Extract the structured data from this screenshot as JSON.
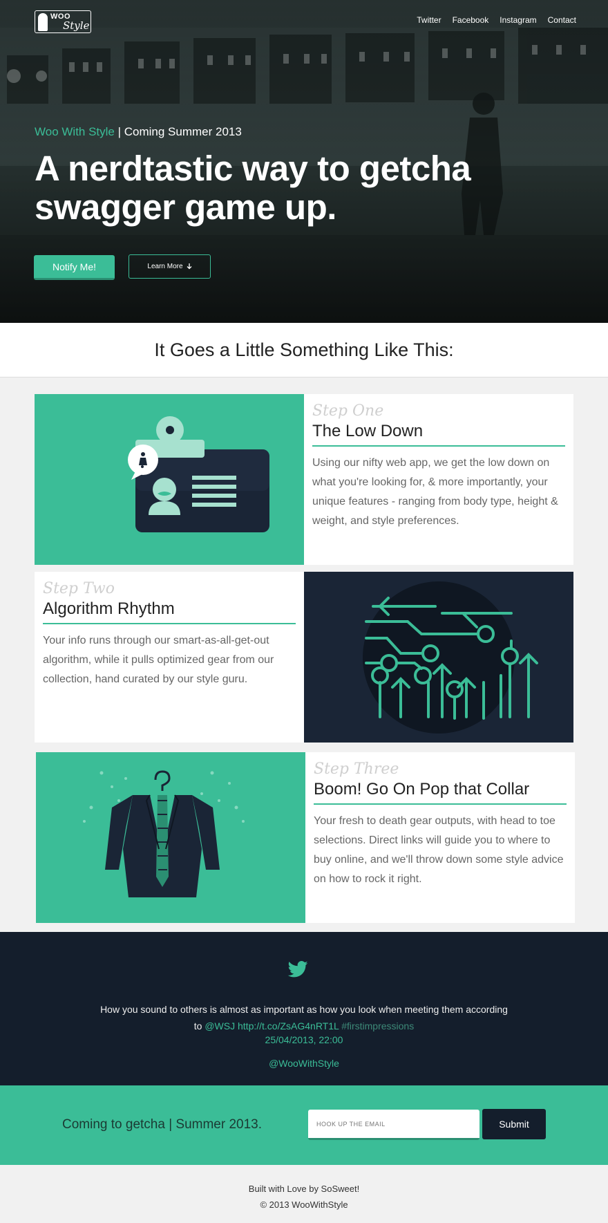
{
  "header": {
    "logo": {
      "line1": "WOO",
      "line2": "Style"
    },
    "nav": [
      "Twitter",
      "Facebook",
      "Instagram",
      "Contact"
    ]
  },
  "hero": {
    "brand": "Woo With Style",
    "tagline_suffix": " | Coming Summer 2013",
    "headline": "A nerdtastic way to getcha swagger game up.",
    "notify_label": "Notify Me!",
    "learn_label": "Learn More"
  },
  "section_title": "It Goes a Little Something Like This:",
  "steps": [
    {
      "label": "Step One",
      "title": "The Low Down",
      "body": "Using our nifty web app, we get the low down on what you're looking for, & more importantly, your unique features - ranging from body type, height & weight, and style preferences."
    },
    {
      "label": "Step Two",
      "title": "Algorithm Rhythm",
      "body": "Your info runs through our smart-as-all-get-out algorithm, while it pulls optimized gear from our collection, hand curated by our style guru."
    },
    {
      "label": "Step Three",
      "title": "Boom! Go On Pop that Collar",
      "body": "Your fresh to death gear outputs, with head to toe selections. Direct links will guide you to where to buy online, and we'll throw down some style advice on how to rock it right."
    }
  ],
  "twitter": {
    "quote_text": "How you sound to others is almost as important as how you look when meeting them according to ",
    "mention": "@WSJ",
    "url": "http://t.co/ZsAG4nRT1L",
    "hashtag": "#firstimpressions",
    "date": "25/04/2013, 22:00",
    "handle": "@WooWithStyle"
  },
  "signup": {
    "message": "Coming to getcha | Summer 2013.",
    "email_placeholder": "HOOK UP THE EMAIL",
    "submit_label": "Submit"
  },
  "footer": {
    "line1": "Built with Love by SoSweet!",
    "line2": "© 2013 WooWithStyle"
  },
  "colors": {
    "accent": "#3bbd97",
    "navy": "#141e2c",
    "hero_dark": "#1c2423"
  }
}
